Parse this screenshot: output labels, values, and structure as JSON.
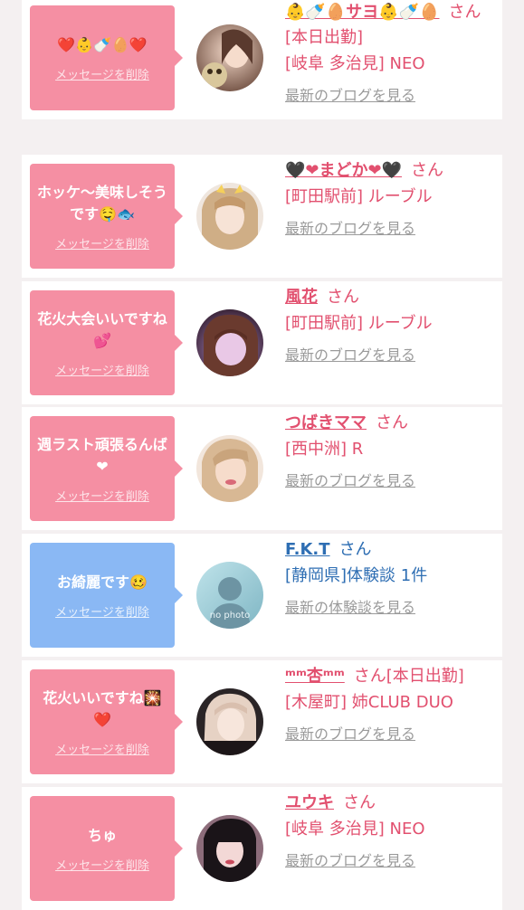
{
  "items": [
    {
      "message": "❤️👶🍼🥚❤️",
      "delete_label": "メッセージを削除",
      "name": "👶🍼🥚サヨ👶🍼🥚",
      "honorific": "さん",
      "status": "[本日出勤]",
      "shop": "[岐阜 多治見] NEO",
      "link": "最新のブログを見る",
      "theme": "pink"
    },
    {
      "message": "ホッケ〜美味しそうです🤤🐟",
      "delete_label": "メッセージを削除",
      "name": "🖤❤まどか❤🖤",
      "honorific": "さん",
      "status": "",
      "shop": "[町田駅前] ルーブル",
      "link": "最新のブログを見る",
      "theme": "pink"
    },
    {
      "message": "花火大会いいですね💕",
      "delete_label": "メッセージを削除",
      "name": "風花",
      "honorific": "さん",
      "status": "",
      "shop": "[町田駅前] ルーブル",
      "link": "最新のブログを見る",
      "theme": "pink"
    },
    {
      "message": "週ラスト頑張るんば❤",
      "delete_label": "メッセージを削除",
      "name": "つばきママ",
      "honorific": "さん",
      "status": "",
      "shop": "[西中洲] R",
      "link": "最新のブログを見る",
      "theme": "pink"
    },
    {
      "message": "お綺麗です🥴",
      "delete_label": "メッセージを削除",
      "name": "F.K.T",
      "honorific": "さん",
      "status": "",
      "shop": "[静岡県]体験談 1件",
      "link": "最新の体験談を見る",
      "theme": "blue",
      "avatar_text": "no photo"
    },
    {
      "message": "花火いいですね🎇❤️",
      "delete_label": "メッセージを削除",
      "name": "ᵐᵐ杏ᵐᵐ",
      "honorific": "さん",
      "status": "[本日出勤]",
      "shop": "[木屋町] 姉CLUB DUO",
      "link": "最新のブログを見る",
      "theme": "pink"
    },
    {
      "message": "ちゅ",
      "delete_label": "メッセージを削除",
      "name": "ユウキ",
      "honorific": "さん",
      "status": "",
      "shop": "[岐阜 多治見] NEO",
      "link": "最新のブログを見る",
      "theme": "pink"
    }
  ],
  "colors": {
    "pink_bubble": "#f58fa3",
    "blue_bubble": "#8ab8f4",
    "pink_text": "#e2506f",
    "blue_text": "#2e6eb3",
    "link_gray": "#9a9a9a"
  }
}
